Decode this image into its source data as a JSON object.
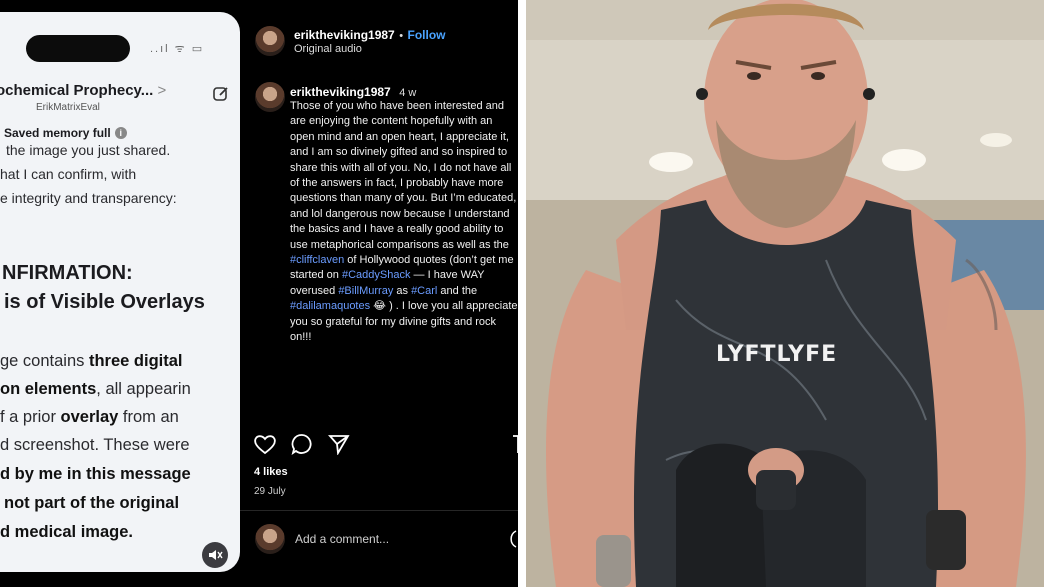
{
  "phone": {
    "title": "ochemical Prophecy...",
    "title_arrow": ">",
    "subtitle": "ErikMatrixEval",
    "memory_label": "Saved memory full",
    "status_icons": "..ıl ᯤ ▭",
    "lines": [
      {
        "text": "the image you just shared."
      },
      {
        "text": "hat I can confirm, with"
      },
      {
        "text": "e integrity and transparency:"
      }
    ],
    "heading_lines": [
      "NFIRMATION:",
      "is of Visible Overlays"
    ],
    "body_lines": [
      {
        "pre": "ge contains ",
        "bold": "three digital",
        "post": ""
      },
      {
        "pre": "",
        "bold": "on elements",
        "post": ", all appearin"
      },
      {
        "pre": "f a prior ",
        "bold": "overlay",
        "post": " from an"
      },
      {
        "pre": "d screenshot. These were",
        "bold": "",
        "post": ""
      },
      {
        "pre": "",
        "bold": "d by me in this message",
        "post": ""
      },
      {
        "pre": "",
        "bold": "not part of the original",
        "post": ""
      },
      {
        "pre": "",
        "bold": "d medical image.",
        "post": ""
      }
    ]
  },
  "instagram": {
    "username": "eriktheviking1987",
    "separator": "•",
    "follow_label": "Follow",
    "audio_label": "Original audio",
    "post_age": "4 w",
    "caption": [
      {
        "t": "Those of you who have been interested and are enjoying the content hopefully with an open mind and an open heart, I appreciate it, and I am so divinely gifted and so inspired to share this with all of you. No, I do not have all of the answers in fact, I probably have more questions than many of you. But I’m educated, and lol dangerous now because I understand the basics and I have a really good ability to use metaphorical comparisons as well as the "
      },
      {
        "tag": "#cliffclaven"
      },
      {
        "t": " of Hollywood quotes (don’t get me started on "
      },
      {
        "tag": "#CaddyShack"
      },
      {
        "t": " — I have WAY overused  "
      },
      {
        "tag": "#BillMurray"
      },
      {
        "t": " as "
      },
      {
        "tag": "#Carl"
      },
      {
        "t": " and the "
      },
      {
        "tag": "#dalilamaquotes"
      },
      {
        "t": " 😂 ) . I love you all appreciate you so grateful for my divine gifts and rock on!!!"
      }
    ],
    "likes": "4 likes",
    "date": "29 July",
    "comment_placeholder": "Add a comment..."
  },
  "photo": {
    "shirt_text": "LYFTLYFE"
  }
}
